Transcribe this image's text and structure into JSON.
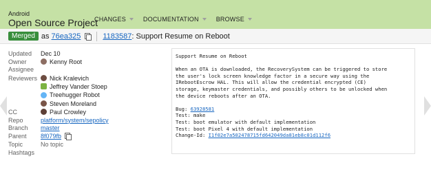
{
  "header": {
    "brand_top": "Android",
    "brand_main": "Open Source Project",
    "nav": [
      "CHANGES",
      "DOCUMENTATION",
      "BROWSE"
    ]
  },
  "subheader": {
    "status": "Merged",
    "as_text": "as",
    "commit": "76ea325",
    "change_number": "1183587",
    "title": ": Support Resume on Reboot"
  },
  "meta": {
    "updated_label": "Updated",
    "updated_value": "Dec 10",
    "owner_label": "Owner",
    "owner_value": "Kenny Root",
    "assignee_label": "Assignee",
    "reviewers_label": "Reviewers",
    "reviewers": [
      "Nick Kralevich",
      "Jeffrey Vander Stoep",
      "Treehugger Robot",
      "Steven Moreland"
    ],
    "cc_label": "CC",
    "cc_value": "Paul Crowley",
    "repo_label": "Repo",
    "repo_value": "platform/system/sepolicy",
    "branch_label": "Branch",
    "branch_value": "master",
    "parent_label": "Parent",
    "parent_value": "8f079fb",
    "topic_label": "Topic",
    "topic_value": "No topic",
    "hashtags_label": "Hashtags"
  },
  "message": {
    "subject": "Support Resume on Reboot",
    "body": [
      "When an OTA is downloaded, the RecoverySystem can be triggered to store",
      "the user's lock screen knowledge factor in a secure way using the",
      "IRebootEscrow HAL. This will allow the credential encrypted (CE)",
      "storage, keymaster credentials, and possibly others to be unlocked when",
      "the device reboots after an OTA."
    ],
    "bug_label": "Bug: ",
    "bug_value": "63928581",
    "tests": [
      "Test: make",
      "Test: boot emulator with default implementation",
      "Test: boot Pixel 4 with default implementation"
    ],
    "change_id_label": "Change-Id: ",
    "change_id_value": "I1f02e7a502478715fd642049da81eb8c01d112f6"
  },
  "colors": {
    "header_bg": "#c5e1a5",
    "merged": "#388e3c",
    "link": "#1565c0"
  }
}
